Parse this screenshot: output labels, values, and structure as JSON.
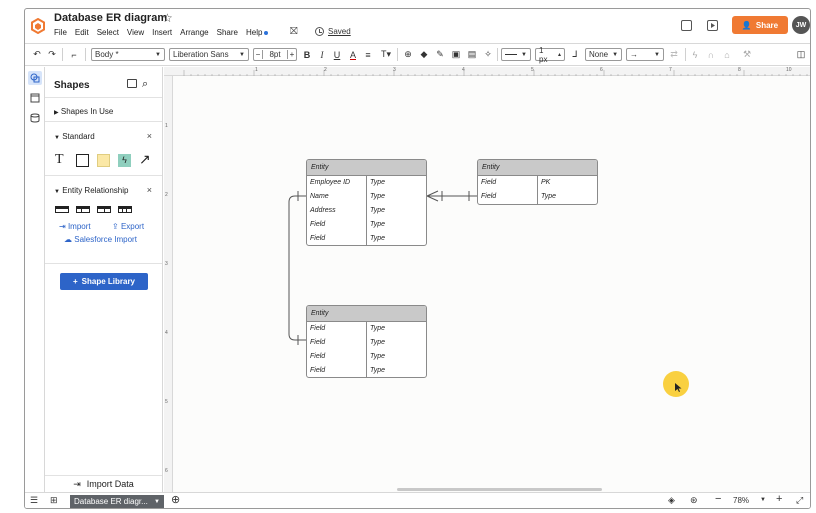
{
  "header": {
    "title": "Database ER diagram",
    "menu": [
      "File",
      "Edit",
      "Select",
      "View",
      "Insert",
      "Arrange",
      "Share",
      "Help"
    ],
    "saved_label": "Saved",
    "share_label": "Share",
    "avatar_initials": "JW",
    "accent_color": "#f07a33"
  },
  "toolbar": {
    "style_value": "Body *",
    "font_value": "Liberation Sans",
    "font_size": "8pt",
    "line_width": "1 px",
    "endpoint_start": "None"
  },
  "panel": {
    "title": "Shapes",
    "shapes_in_use": "Shapes In Use",
    "standard": "Standard",
    "entity_relationship": "Entity Relationship",
    "import_label": "Import",
    "export_label": "Export",
    "salesforce_label": "Salesforce Import",
    "shape_library_label": "Shape Library",
    "import_data_label": "Import Data"
  },
  "ruler": {
    "top": [
      "1",
      "2",
      "3",
      "4",
      "5",
      "6",
      "7",
      "8",
      "9",
      "10"
    ],
    "left": [
      "1",
      "2",
      "3",
      "4",
      "5",
      "6"
    ]
  },
  "entities": [
    {
      "title": "Entity",
      "rows": [
        {
          "field": "Employee ID",
          "type": "Type"
        },
        {
          "field": "Name",
          "type": "Type"
        },
        {
          "field": "Address",
          "type": "Type"
        },
        {
          "field": "Field",
          "type": "Type"
        },
        {
          "field": "Field",
          "type": "Type"
        }
      ]
    },
    {
      "title": "Entity",
      "rows": [
        {
          "field": "Field",
          "type": "PK"
        },
        {
          "field": "Field",
          "type": "Type"
        }
      ]
    },
    {
      "title": "Entity",
      "rows": [
        {
          "field": "Field",
          "type": "Type"
        },
        {
          "field": "Field",
          "type": "Type"
        },
        {
          "field": "Field",
          "type": "Type"
        },
        {
          "field": "Field",
          "type": "Type"
        }
      ]
    }
  ],
  "bottom": {
    "page_tab_label": "Database ER diagr...",
    "zoom_level": "78%"
  }
}
